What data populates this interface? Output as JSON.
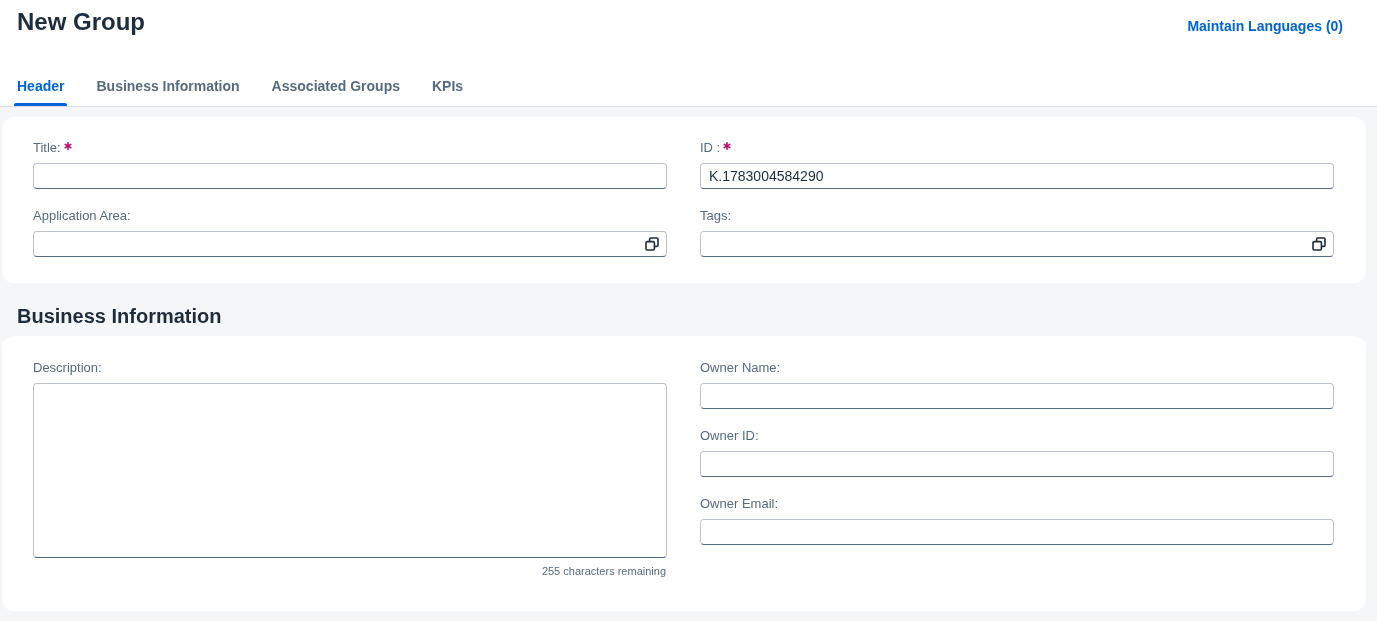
{
  "page": {
    "title": "New Group",
    "link": "Maintain Languages (0)"
  },
  "tabs": [
    {
      "label": "Header",
      "selected": true
    },
    {
      "label": "Business Information",
      "selected": false
    },
    {
      "label": "Associated Groups",
      "selected": false
    },
    {
      "label": "KPIs",
      "selected": false
    }
  ],
  "header": {
    "fields": [
      {
        "label": "Title:",
        "required": true,
        "kind": "text"
      },
      {
        "label": "ID :",
        "required": true,
        "kind": "text",
        "value": "K.1783004584290"
      },
      {
        "label": "Application Area:",
        "required": false,
        "kind": "value_help"
      },
      {
        "label": "Tags:",
        "required": false,
        "kind": "value_help"
      }
    ]
  },
  "business_information": {
    "heading": "Business Information",
    "description": {
      "label": "Description:",
      "counter": "255 characters remaining"
    },
    "fields": [
      {
        "label": "Owner Name:",
        "required": false,
        "kind": "text"
      },
      {
        "label": "Owner ID:",
        "required": false,
        "kind": "text"
      },
      {
        "label": "Owner Email:",
        "required": false,
        "kind": "text"
      }
    ]
  }
}
